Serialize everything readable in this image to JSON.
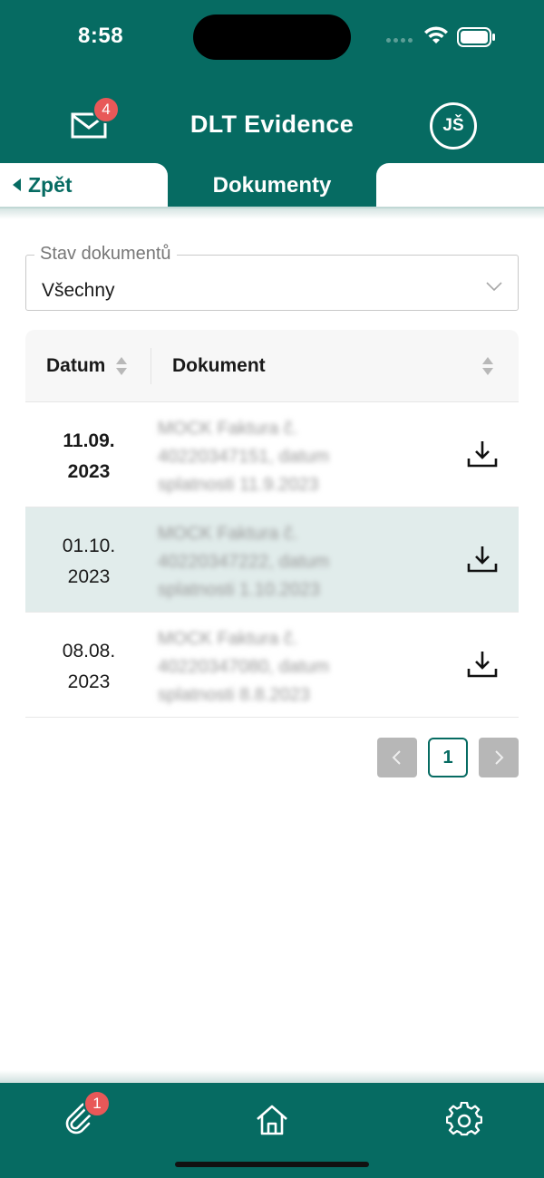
{
  "status": {
    "time": "8:58"
  },
  "header": {
    "title": "DLT Evidence",
    "mail_badge": "4",
    "avatar_initials": "JŠ"
  },
  "nav": {
    "back_label": "Zpět",
    "active_tab": "Dokumenty"
  },
  "filter": {
    "legend": "Stav dokumentů",
    "value": "Všechny"
  },
  "table": {
    "columns": [
      "Datum",
      "Dokument"
    ],
    "rows": [
      {
        "date_line1": "11.09.",
        "date_line2": "2023",
        "doc_line1": "MOCK Faktura č.",
        "doc_line2": "40220347151, datum",
        "doc_line3": "splatnosti 11.9.2023"
      },
      {
        "date_line1": "01.10.",
        "date_line2": "2023",
        "doc_line1": "MOCK Faktura č.",
        "doc_line2": "40220347222, datum",
        "doc_line3": "splatnosti 1.10.2023"
      },
      {
        "date_line1": "08.08.",
        "date_line2": "2023",
        "doc_line1": "MOCK Faktura č.",
        "doc_line2": "40220347080, datum",
        "doc_line3": "splatnosti 8.8.2023"
      }
    ]
  },
  "pagination": {
    "current_page": "1"
  },
  "bottom_nav": {
    "attach_badge": "1"
  },
  "colors": {
    "brand": "#066b62",
    "badge": "#e85858",
    "highlight_row": "#e1eceb"
  }
}
